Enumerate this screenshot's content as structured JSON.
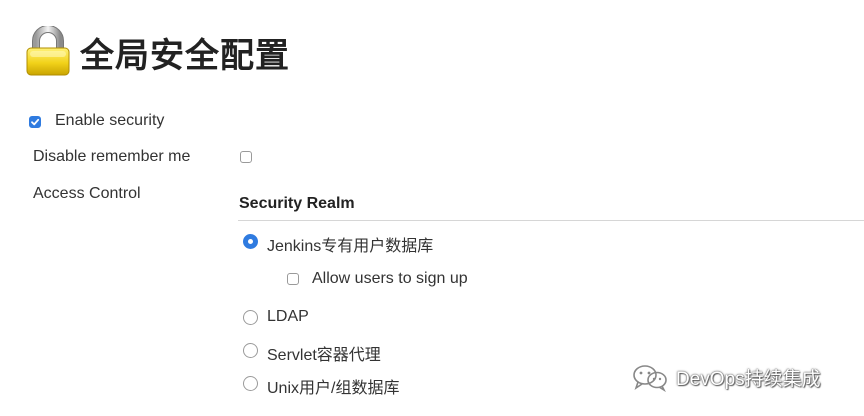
{
  "header": {
    "title": "全局安全配置",
    "icon": "lock-icon"
  },
  "form": {
    "enable_security": {
      "label": "Enable security",
      "checked": true
    },
    "disable_remember_me": {
      "label": "Disable remember me",
      "checked": false
    },
    "access_control": {
      "label": "Access Control"
    }
  },
  "security_realm": {
    "title": "Security Realm",
    "options": [
      {
        "label": "Jenkins专有用户数据库",
        "selected": true
      },
      {
        "label": "LDAP",
        "selected": false
      },
      {
        "label": "Servlet容器代理",
        "selected": false
      },
      {
        "label": "Unix用户/组数据库",
        "selected": false
      }
    ],
    "allow_signup": {
      "label": "Allow users to sign up",
      "checked": false
    }
  },
  "watermark": {
    "text": "DevOps持续集成",
    "icon": "wechat-icon"
  },
  "colors": {
    "accent": "#2f7be0",
    "lock_body": "#f2d21a",
    "divider": "#d6d6d6"
  }
}
